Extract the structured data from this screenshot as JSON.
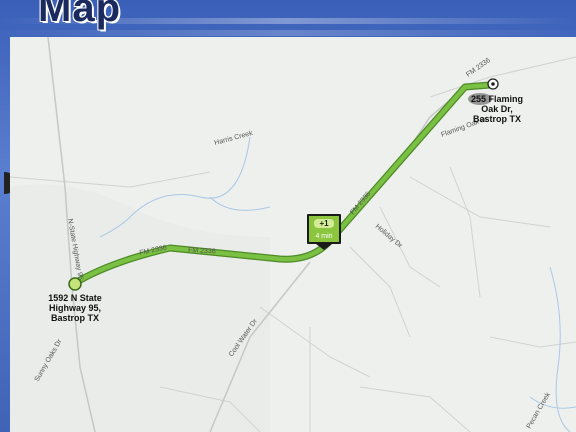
{
  "slide": {
    "title": "Map"
  },
  "map": {
    "roads": {
      "fm_2336_a": "FM 2336",
      "fm_2336_b": "FM 2336",
      "fm_2336_c": "FM 2336",
      "fm_2336_d": "FM 2336",
      "state_highway": "N-State Highway 95",
      "flaming_oak": "Flaming Oak Dr",
      "creek": "Harris Creek",
      "holiday": "Holiday Dr",
      "cool_water": "Cool Water Dr",
      "sunny_oaks": "Sunny Oaks Dr",
      "pecan_creek": "Pecan Creek"
    },
    "start": {
      "line1": "1592 N State",
      "line2": "Highway 95,",
      "line3": "Bastrop TX"
    },
    "end": {
      "line1": "255 Flaming",
      "line2": "Oak Dr,",
      "line3": "Bastrop TX"
    },
    "route_badge": {
      "top": "+1",
      "bottom": "4 min"
    },
    "colors": {
      "route": "#7ac043",
      "route_outline": "#4e8a27",
      "badge": "#8cc63f",
      "water": "#a9c8e6"
    }
  }
}
